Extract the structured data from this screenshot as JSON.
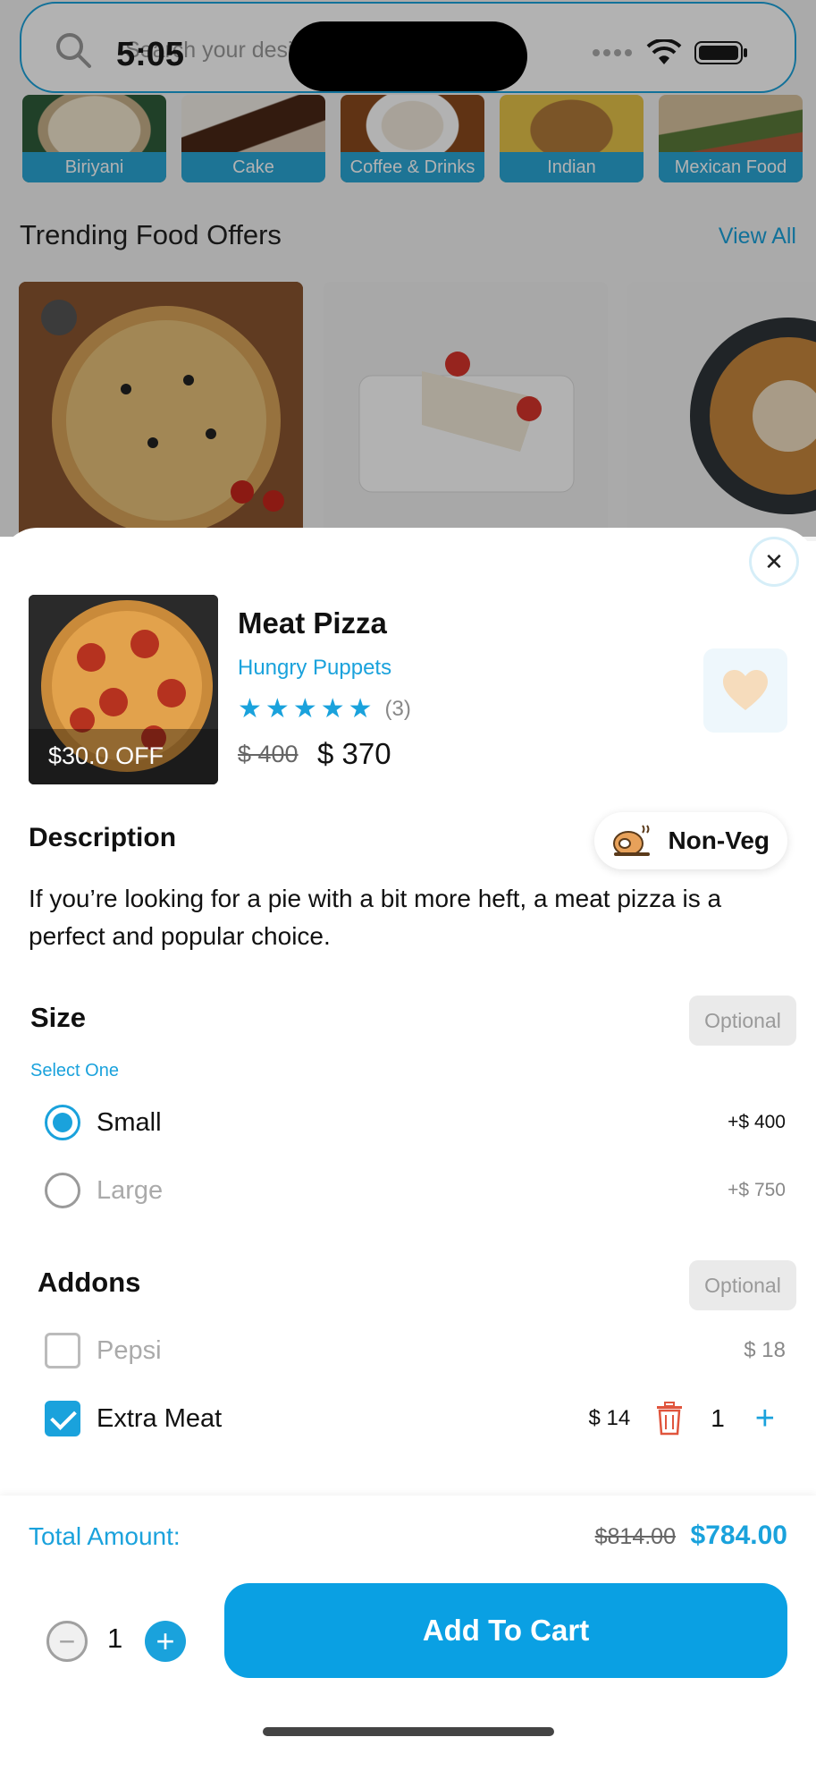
{
  "status_bar": {
    "time": "5:05"
  },
  "search": {
    "placeholder": "Search your desired food"
  },
  "categories": [
    {
      "label": "Biriyani"
    },
    {
      "label": "Cake"
    },
    {
      "label": "Coffee & Drinks"
    },
    {
      "label": "Indian"
    },
    {
      "label": "Mexican Food"
    }
  ],
  "trending": {
    "title": "Trending Food Offers",
    "view_all": "View All"
  },
  "product": {
    "name": "Meat Pizza",
    "restaurant": "Hungry Puppets",
    "rating_stars": 5,
    "rating_count": "(3)",
    "discount_badge": "$30.0 OFF",
    "price_old": "$ 400",
    "price_new": "$ 370",
    "diet_tag": "Non-Veg"
  },
  "description": {
    "title": "Description",
    "text": "If you’re looking for a pie with a bit more heft, a meat pizza is a perfect and popular choice."
  },
  "size": {
    "title": "Size",
    "badge": "Optional",
    "hint": "Select One",
    "options": [
      {
        "label": "Small",
        "price": "+$ 400",
        "selected": true
      },
      {
        "label": "Large",
        "price": "+$ 750",
        "selected": false
      }
    ]
  },
  "addons": {
    "title": "Addons",
    "badge": "Optional",
    "items": [
      {
        "label": "Pepsi",
        "price": "$ 18",
        "checked": false
      },
      {
        "label": "Extra Meat",
        "price": "$ 14",
        "checked": true,
        "qty": "1"
      }
    ]
  },
  "footer": {
    "total_label": "Total Amount:",
    "total_old": "$814.00",
    "total_new": "$784.00",
    "quantity": "1",
    "add_to_cart": "Add To Cart"
  },
  "colors": {
    "accent": "#1aa2dc",
    "button": "#0aa0e3",
    "trash": "#e0553d",
    "heart": "#f6dcbc"
  }
}
